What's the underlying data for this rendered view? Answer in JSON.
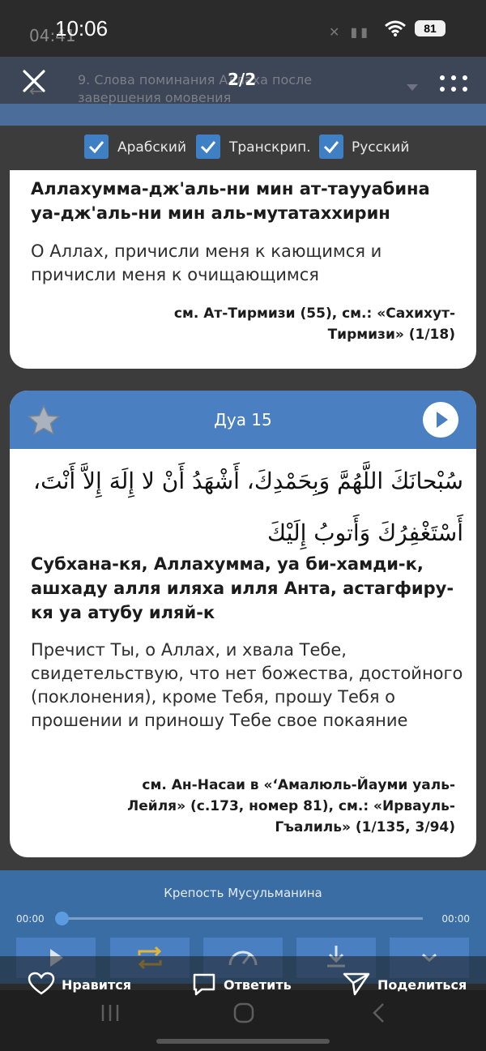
{
  "status_bar": {
    "time": "10:06",
    "time_behind": "04:41",
    "battery": "81"
  },
  "header": {
    "chapter_title": "9. Слова поминания Аллаха после завершения омовения",
    "counter": "2/2"
  },
  "languages": [
    {
      "label": "Арабский",
      "checked": true
    },
    {
      "label": "Транскрип.",
      "checked": true
    },
    {
      "label": "Русский",
      "checked": true
    }
  ],
  "card1": {
    "transliteration": "Аллахумма-дж'аль-ни мин ат-таууабина уа-дж'аль-ни мин аль-мутатаххирин",
    "translation": "О Аллах, причисли меня к кающимся и причисли меня к очищающимся",
    "source": "см. Ат-Тирмизи (55), см.: «Сахихут-Тирмизи» (1/18)"
  },
  "card2": {
    "title": "Дуа 15",
    "arabic": "سُبْحانَكَ اللَّهُمَّ وَبِحَمْدِكَ، أَشْهَدُ أَنْ لا إِلَهَ إِلاَّ أَنْتَ، أَسْتَغْفِرُكَ وَأَتوبُ إِلَيْكَ",
    "transliteration": "Субхана-кя, Аллахумма, уа би-хамди-к, ашхаду алля иляха илля Анта, астагфиру-кя уа атубу иляй-к",
    "translation": "Пречист Ты, о Аллах, и хвала Тебе, свидетельствую, что нет божества, достойного (поклонения), кроме Тебя, прошу Тебя о прошении и приношу Тебе свое покаяние",
    "source": "см. Ан-Насаи в «‘Амалюль-Йауми уаль-Лейля» (с.173, номер 81), см.: «Ирвауль-Гъалиль» (1/135, 3/94)"
  },
  "player": {
    "title": "Крепость Мусульманина",
    "time_start": "00:00",
    "time_end": "00:00",
    "progress": 0
  },
  "reply_bar": {
    "like": "Нравится",
    "reply": "Ответить",
    "share": "Поделиться"
  },
  "colors": {
    "accent": "#4a7fc1",
    "player": "#3b6da5",
    "appbar": "#3d4656"
  }
}
